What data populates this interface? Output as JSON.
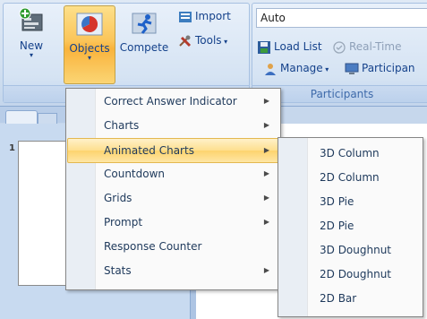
{
  "ribbon": {
    "new_label": "New",
    "objects_label": "Objects",
    "compete_label": "Compete",
    "import_label": "Import",
    "tools_label": "Tools",
    "auto_value": "Auto",
    "load_list_label": "Load List",
    "realtime_label": "Real-Time",
    "manage_label": "Manage",
    "participants_btn_label": "Participan",
    "participants_group_label": "Participants"
  },
  "slides": {
    "first_number": "1"
  },
  "objects_menu": {
    "items": [
      {
        "label": "Correct Answer Indicator",
        "submenu": true
      },
      {
        "label": "Charts",
        "submenu": true
      },
      {
        "label": "Animated Charts",
        "submenu": true,
        "highlighted": true
      },
      {
        "label": "Countdown",
        "submenu": true
      },
      {
        "label": "Grids",
        "submenu": true
      },
      {
        "label": "Prompt",
        "submenu": true
      },
      {
        "label": "Response Counter",
        "submenu": false
      },
      {
        "label": "Stats",
        "submenu": true
      }
    ],
    "arrow": "▶"
  },
  "animated_charts_menu": {
    "items": [
      {
        "label": "3D Column"
      },
      {
        "label": "2D Column"
      },
      {
        "label": "3D Pie"
      },
      {
        "label": "2D Pie"
      },
      {
        "label": "3D Doughnut"
      },
      {
        "label": "2D Doughnut"
      },
      {
        "label": "2D Bar"
      }
    ]
  },
  "colors": {
    "highlight": "#fedf8e",
    "ribbon": "#d3e1f1",
    "label_text": "#1e395b"
  }
}
